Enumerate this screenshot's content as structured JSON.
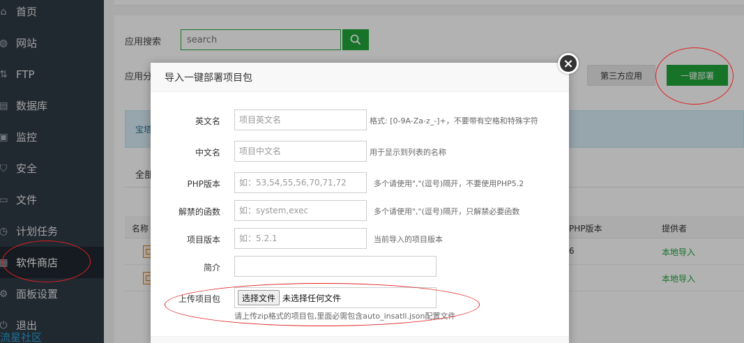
{
  "sidebar": {
    "items": [
      {
        "label": "首页",
        "icon": "home-icon"
      },
      {
        "label": "网站",
        "icon": "globe-icon"
      },
      {
        "label": "FTP",
        "icon": "ftp-icon"
      },
      {
        "label": "数据库",
        "icon": "database-icon"
      },
      {
        "label": "监控",
        "icon": "monitor-icon"
      },
      {
        "label": "安全",
        "icon": "shield-icon"
      },
      {
        "label": "文件",
        "icon": "folder-icon"
      },
      {
        "label": "计划任务",
        "icon": "clock-icon"
      },
      {
        "label": "软件商店",
        "icon": "grid-icon",
        "active": true
      },
      {
        "label": "面板设置",
        "icon": "gear-icon"
      },
      {
        "label": "退出",
        "icon": "logout-icon"
      }
    ],
    "brand": "流星社区"
  },
  "main": {
    "search_label": "应用搜索",
    "search_placeholder": "search",
    "category_label": "应用分",
    "third_party_label": "第三方应用",
    "deploy_label": "一键部署",
    "info_text": "宝塔",
    "tab_all": "全部",
    "table": {
      "headers": {
        "name": "名称",
        "php": "PHP版本",
        "provider": "提供者"
      },
      "rows": [
        {
          "php": "6",
          "provider": "本地导入"
        },
        {
          "php": "",
          "provider": "本地导入"
        }
      ]
    }
  },
  "modal": {
    "title": "导入一键部署项目包",
    "fields": {
      "en_name": {
        "label": "英文名",
        "placeholder": "项目英文名",
        "hint": "格式: [0-9A-Za-z_-]+，不要带有空格和特殊字符"
      },
      "cn_name": {
        "label": "中文名",
        "placeholder": "项目中文名",
        "hint": "用于显示到列表的名称"
      },
      "php": {
        "label": "PHP版本",
        "placeholder": "如：53,54,55,56,70,71,72",
        "hint": "多个请使用\",\"(逗号)隔开，不要使用PHP5.2"
      },
      "disable_funcs": {
        "label": "解禁的函数",
        "placeholder": "如：system,exec",
        "hint": "多个请使用\",\"(逗号)隔开，只解禁必要函数"
      },
      "version": {
        "label": "项目版本",
        "placeholder": "如：5.2.1",
        "hint": "当前导入的项目版本"
      },
      "intro": {
        "label": "简介",
        "placeholder": ""
      },
      "upload": {
        "label": "上传项目包",
        "button": "选择文件",
        "status": "未选择任何文件",
        "hint": "请上传zip格式的项目包,里面必需包含auto_insatll.json配置文件"
      }
    },
    "close_icon": "close-icon"
  },
  "colors": {
    "accent": "#20a53a",
    "sidebar": "#2f3a46",
    "annotation": "#e02020"
  }
}
